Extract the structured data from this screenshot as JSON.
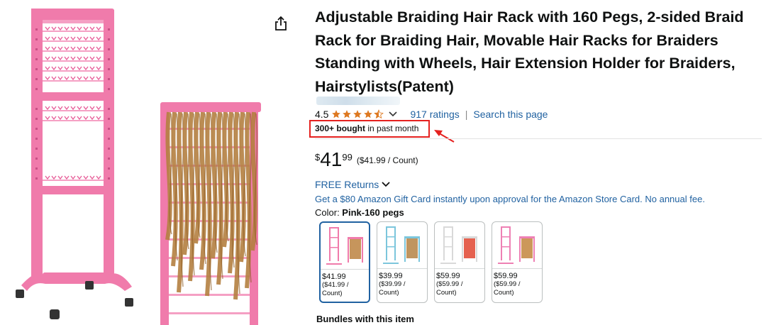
{
  "product": {
    "title": "Adjustable Braiding Hair Rack with 160 Pegs, 2-sided Braid Rack for Braiding Hair, Movable Hair Racks for Braiders Standing with Wheels, Hair Extension Holder for Braiders, Hairstylists(Patent)",
    "rating_value": "4.5",
    "rating_stars": 4.5,
    "ratings_link": "917 ratings",
    "search_link": "Search this page",
    "separator": "|",
    "bought_bold": "300+ bought",
    "bought_rest": " in past month",
    "price_symbol": "$",
    "price_whole": "41",
    "price_fraction": "99",
    "unit_price": "($41.99 / Count)",
    "returns_label": "FREE Returns",
    "gift_card_text": "Get a $80 Amazon Gift Card instantly upon approval for the Amazon Store Card. No annual fee.",
    "color_label": "Color: ",
    "color_value": "Pink-160 pegs",
    "bundles_label": "Bundles with this item"
  },
  "swatches": [
    {
      "price": "$41.99",
      "unit": "($41.99 /",
      "unit2": "Count)",
      "frame_color": "#f07bab",
      "hair_color": "#c08a4a",
      "selected": true
    },
    {
      "price": "$39.99",
      "unit": "($39.99 /",
      "unit2": "Count)",
      "frame_color": "#7cc6dc",
      "hair_color": "#b98a4f",
      "selected": false
    },
    {
      "price": "$59.99",
      "unit": "($59.99 /",
      "unit2": "Count)",
      "frame_color": "#d9d9d9",
      "hair_color": "#e2503c",
      "selected": false
    },
    {
      "price": "$59.99",
      "unit": "($59.99 /",
      "unit2": "Count)",
      "frame_color": "#ee80b4",
      "hair_color": "#c78d48",
      "selected": false
    }
  ],
  "colors": {
    "link": "#2162a1",
    "star": "#de7921",
    "highlight_box": "#e5211f",
    "rack_pink": "#f07bab",
    "hair_blonde": "#b48040"
  },
  "icons": [
    "share-icon",
    "star-icon",
    "chevron-down-icon",
    "red-arrow-icon"
  ]
}
